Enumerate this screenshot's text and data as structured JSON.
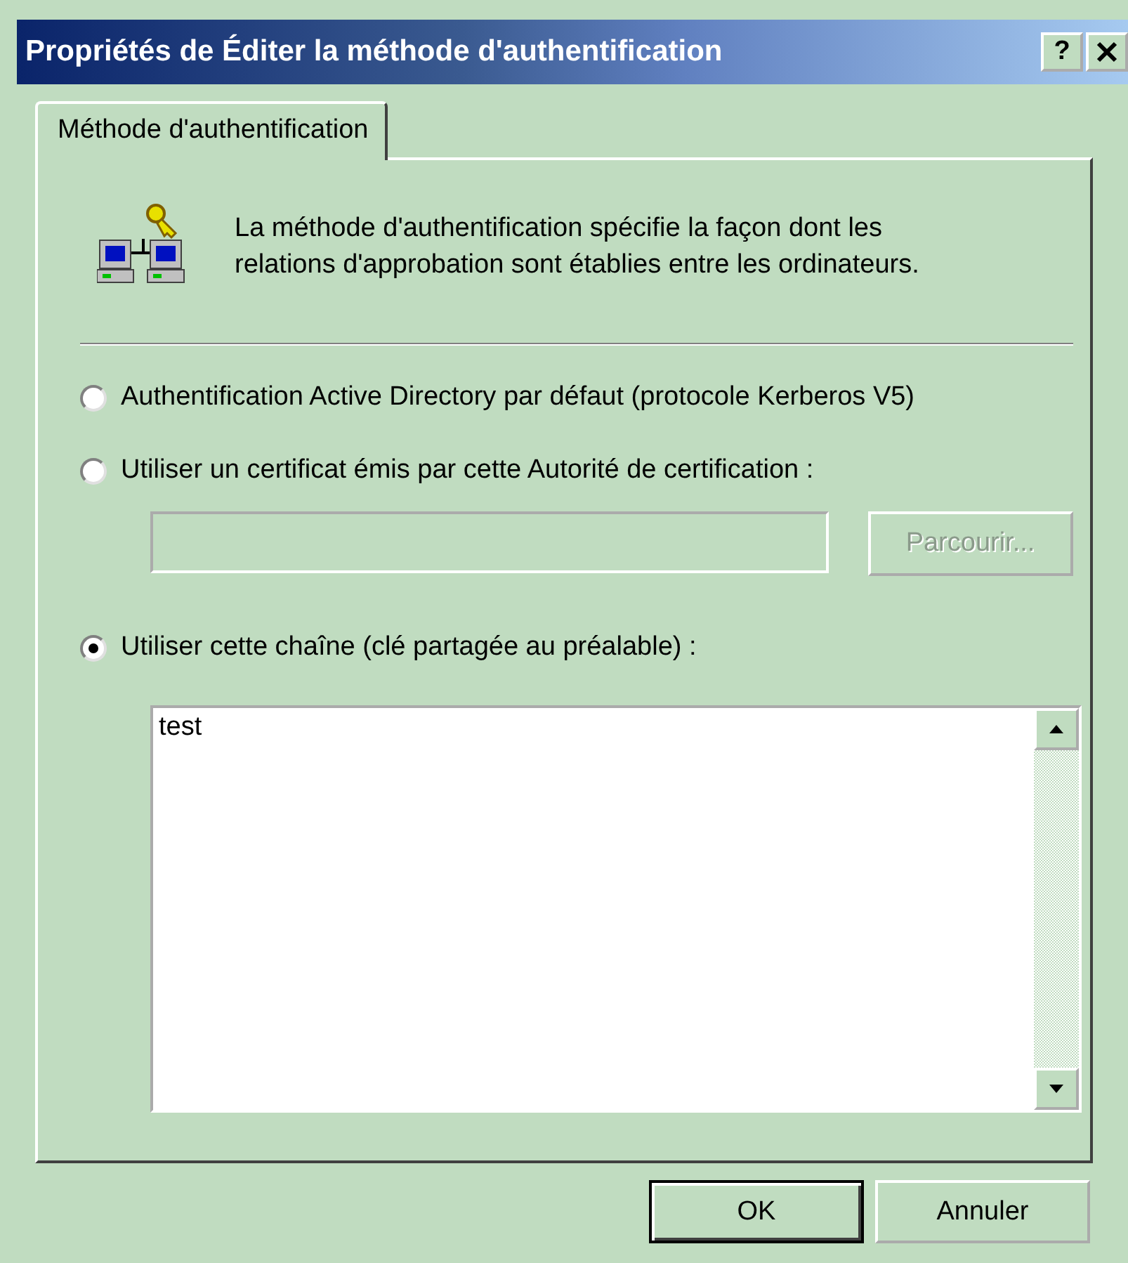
{
  "window": {
    "title": "Propriétés de Éditer la méthode d'authentification",
    "help_button": "?"
  },
  "tabs": [
    {
      "label": "Méthode d'authentification",
      "selected": true
    }
  ],
  "description": "La méthode d'authentification spécifie la façon dont les relations d'approbation sont établies entre les ordinateurs.",
  "options": [
    {
      "kind": "radio",
      "label": "Authentification Active Directory par défaut (protocole Kerberos V5)",
      "selected": false
    },
    {
      "kind": "radio",
      "label": "Utiliser un certificat émis par cette Autorité de certification :",
      "selected": false
    },
    {
      "kind": "field_row",
      "disabled": true,
      "button": "Parcourir..."
    },
    {
      "kind": "radio",
      "label": "Utiliser cette chaîne (clé partagée au préalable) :",
      "selected": true
    },
    {
      "kind": "textarea",
      "value": "test"
    }
  ],
  "buttons": [
    {
      "label": "OK",
      "default": true
    },
    {
      "label": "Annuler",
      "default": false
    }
  ]
}
